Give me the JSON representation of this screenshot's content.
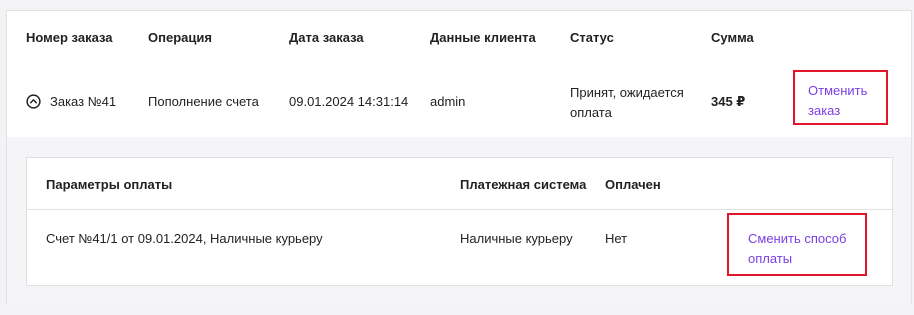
{
  "orders_table": {
    "headers": {
      "order_number": "Номер заказа",
      "operation": "Операция",
      "order_date": "Дата заказа",
      "client_data": "Данные клиента",
      "status": "Статус",
      "sum": "Сумма"
    },
    "row": {
      "order_number": "Заказ №41",
      "operation": "Пополнение счета",
      "order_date": "09.01.2024 14:31:14",
      "client": "admin",
      "status": "Принят, ожидается оплата",
      "sum": "345 ₽",
      "cancel_link": "Отменить заказ",
      "toggle_icon": "chevron-up-circle"
    }
  },
  "payment_details": {
    "headers": {
      "params": "Параметры оплаты",
      "system": "Платежная система",
      "paid": "Оплачен"
    },
    "row": {
      "params": "Счет №41/1 от 09.01.2024, Наличные курьеру",
      "system": "Наличные курьеру",
      "paid": "Нет",
      "change_link": "Сменить способ оплаты"
    }
  },
  "colors": {
    "accent_link": "#7b3fe4",
    "highlight_box": "#e2162a"
  }
}
